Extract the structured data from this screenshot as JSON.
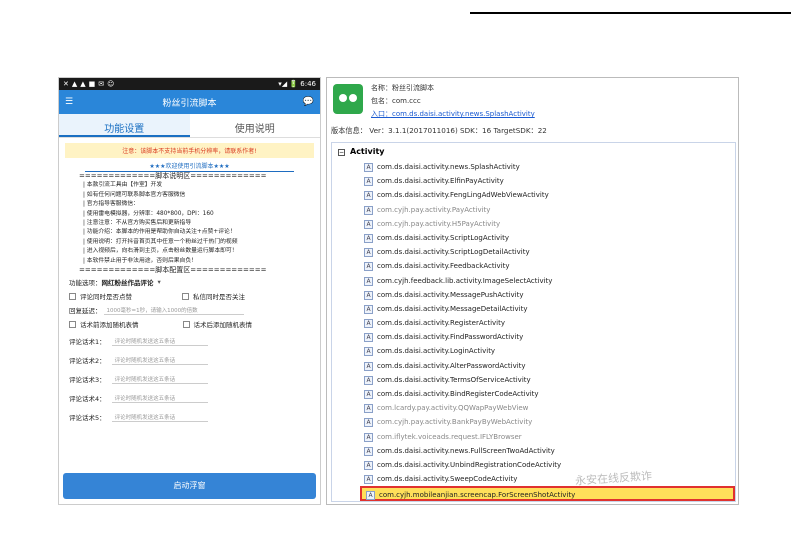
{
  "phone": {
    "status": {
      "left_icons": [
        "✕",
        "▲",
        "▲",
        "■",
        "✉",
        "☺"
      ],
      "right": "▾◢ 🔋 6:46"
    },
    "title": "粉丝引流脚本",
    "tabs": [
      "功能设置",
      "使用说明"
    ],
    "warning": "注意：该脚本不支持当前手机分辨率，请联系作者!",
    "welcome": "★★★欢迎使用引流脚本★★★",
    "info_header": "=============脚本说明区=============",
    "info_lines": [
      "| 本款引流工具由【作室】开发",
      "| 如有任何问题可联系脚本官方客服微信",
      "| 官方指导客服微信：",
      "| 使用雷电模拟器，分辨率：480*800，DPI：160",
      "| 注意注意：不从官方购买售后和更新指导",
      "| 功能介绍：本脚本的作用是帮助你自动关注+点赞+评论！",
      "| 使用说明：打开抖音首页其中任意一个粉丝过千热门的视频",
      "| 进入视频后，向右滑到主页，点击粉丝数量运行脚本即可！",
      "| 本软件禁止用于非法用途，否则后果自负！"
    ],
    "config_header": "=============脚本配置区=============",
    "function_label": "功能选项：",
    "function_value": "网红粉丝作品评论",
    "opt1": "评论同时是否点赞",
    "opt2": "私信同时是否关注",
    "delay_label": "回复延迟：",
    "delay_placeholder": "1000毫秒=1秒，请输入1000的倍数",
    "opt3": "话术前添加随机表情",
    "opt4": "话术后添加随机表情",
    "scripts": [
      {
        "label": "评论话术1：",
        "placeholder": "评论时随机发送这五条话"
      },
      {
        "label": "评论话术2：",
        "placeholder": "评论时随机发送这五条话"
      },
      {
        "label": "评论话术3：",
        "placeholder": "评论时随机发送这五条话"
      },
      {
        "label": "评论话术4：",
        "placeholder": "评论时随机发送这五条话"
      },
      {
        "label": "评论话术5：",
        "placeholder": "评论时随机发送这五条话"
      }
    ],
    "start_button": "启动浮窗"
  },
  "panel": {
    "name": "名称：粉丝引流脚本",
    "package": "包名：com.ccc",
    "entry_label": "入口：",
    "entry": "com.ds.daisi.activity.news.SplashActivity",
    "version": "版本信息：  Ver：3.1.1(2017011016)  SDK：16  TargetSDK：22",
    "tree_header": "Activity",
    "activities": [
      {
        "name": "com.ds.daisi.activity.news.SplashActivity",
        "dim": false
      },
      {
        "name": "com.ds.daisi.activity.ElfinPayActivity",
        "dim": false
      },
      {
        "name": "com.ds.daisi.activity.FengLingAdWebViewActivity",
        "dim": false
      },
      {
        "name": "com.cyjh.pay.activity.PayActivity",
        "dim": true
      },
      {
        "name": "com.cyjh.pay.activity.H5PayActivity",
        "dim": true
      },
      {
        "name": "com.ds.daisi.activity.ScriptLogActivity",
        "dim": false
      },
      {
        "name": "com.ds.daisi.activity.ScriptLogDetailActivity",
        "dim": false
      },
      {
        "name": "com.ds.daisi.activity.FeedbackActivity",
        "dim": false
      },
      {
        "name": "com.cyjh.feedback.lib.activity.ImageSelectActivity",
        "dim": false
      },
      {
        "name": "com.ds.daisi.activity.MessagePushActivity",
        "dim": false
      },
      {
        "name": "com.ds.daisi.activity.MessageDetailActivity",
        "dim": false
      },
      {
        "name": "com.ds.daisi.activity.RegisterActivity",
        "dim": false
      },
      {
        "name": "com.ds.daisi.activity.FindPasswordActivity",
        "dim": false
      },
      {
        "name": "com.ds.daisi.activity.LoginActivity",
        "dim": false
      },
      {
        "name": "com.ds.daisi.activity.AlterPasswordActivity",
        "dim": false
      },
      {
        "name": "com.ds.daisi.activity.TermsOfServiceActivity",
        "dim": false
      },
      {
        "name": "com.ds.daisi.activity.BindRegisterCodeActivity",
        "dim": false
      },
      {
        "name": "com.lcardy.pay.activity.QQWapPayWebView",
        "dim": true
      },
      {
        "name": "com.cyjh.pay.activity.BankPayByWebActivity",
        "dim": true
      },
      {
        "name": "com.iflytek.voiceads.request.IFLYBrowser",
        "dim": true
      },
      {
        "name": "com.ds.daisi.activity.news.FullScreenTwoAdActivity",
        "dim": false
      },
      {
        "name": "com.ds.daisi.activity.UnbindRegistrationCodeActivity",
        "dim": false
      },
      {
        "name": "com.ds.daisi.activity.SweepCodeActivity",
        "dim": false
      }
    ],
    "highlight": "com.cyjh.mobileanjian.screencap.ForScreenShotActivity"
  },
  "watermark": "永安在线反欺诈"
}
